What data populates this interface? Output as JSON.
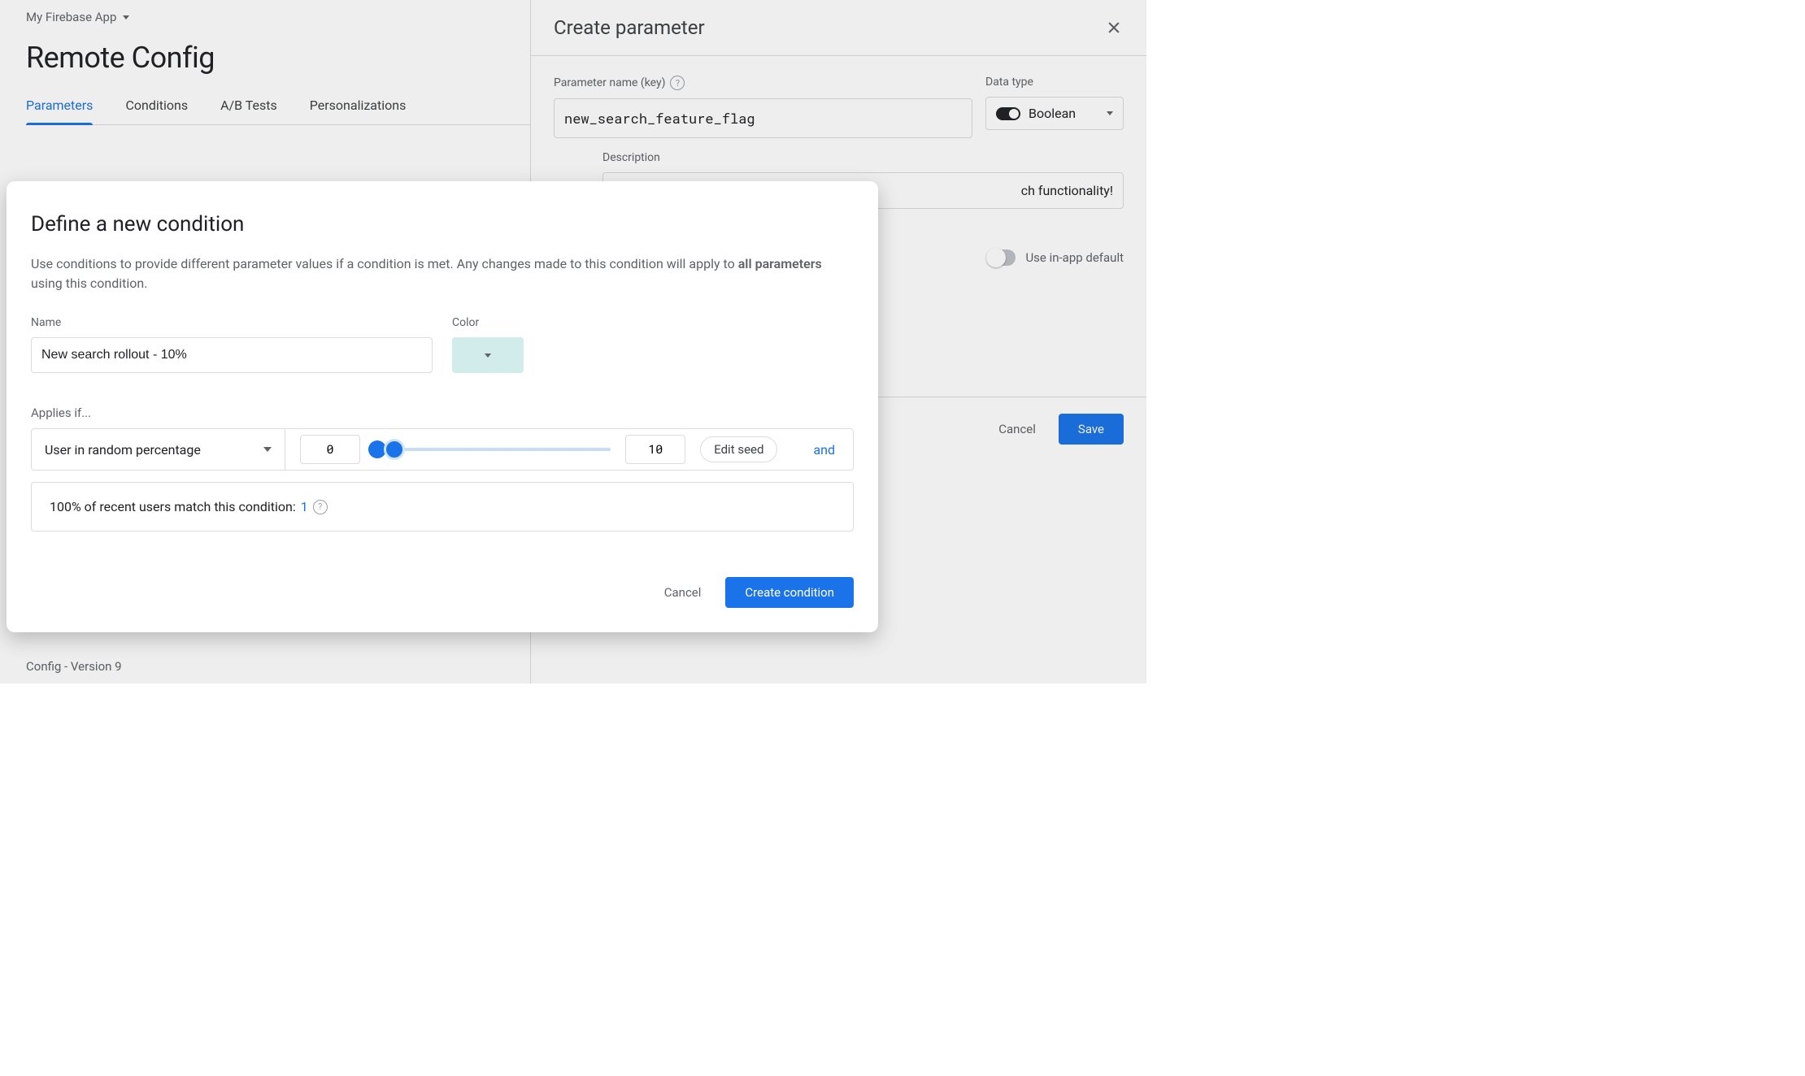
{
  "header": {
    "app_name": "My Firebase App",
    "page_title": "Remote Config",
    "tabs": [
      "Parameters",
      "Conditions",
      "A/B Tests",
      "Personalizations"
    ],
    "active_tab": 0
  },
  "footer": {
    "version_text": "Config - Version 9"
  },
  "side_panel": {
    "title": "Create parameter",
    "param_name_label": "Parameter name (key)",
    "param_name_value": "new_search_feature_flag",
    "data_type_label": "Data type",
    "data_type_value": "Boolean",
    "description_label": "Description",
    "description_value_suffix": "ch functionality!",
    "use_default_label": "Use in-app default",
    "cancel_label": "Cancel",
    "save_label": "Save"
  },
  "modal": {
    "title": "Define a new condition",
    "desc_prefix": "Use conditions to provide different parameter values if a condition is met. Any changes made to this condition will apply to ",
    "desc_bold": "all parameters",
    "desc_suffix": " using this condition.",
    "name_label": "Name",
    "name_value": "New search rollout - 10%",
    "color_label": "Color",
    "color_value": "#d2ebeb",
    "applies_label": "Applies if...",
    "applies_select": "User in random percentage",
    "range_low": "0",
    "range_high": "10",
    "edit_seed_label": "Edit seed",
    "and_label": "and",
    "match_text_prefix": "100% of recent users match this condition: ",
    "match_count": "1",
    "cancel_label": "Cancel",
    "create_label": "Create condition"
  }
}
